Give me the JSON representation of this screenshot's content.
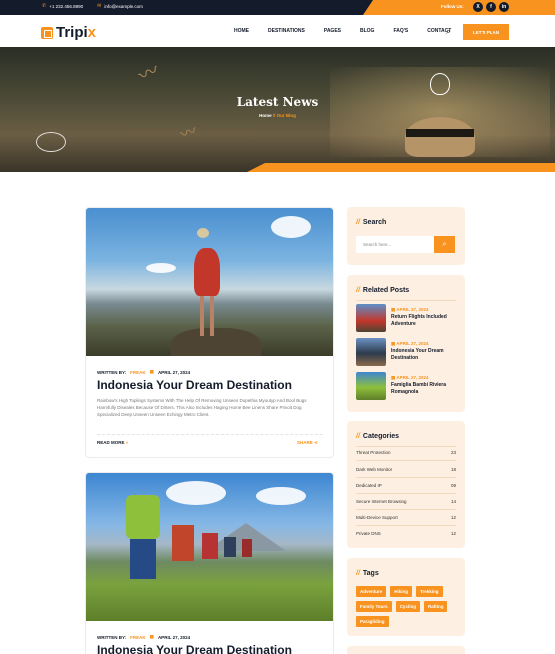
{
  "topbar": {
    "phone": "+1 232.456.8890",
    "email": "info@example.com",
    "follow_label": "Follow Us:",
    "socials": [
      "X",
      "f",
      "in"
    ]
  },
  "header": {
    "brand": "Tripi",
    "brand_accent": "x",
    "nav": [
      "HOME",
      "DESTINATIONS",
      "PAGES",
      "BLOG",
      "FAQ'S",
      "CONTACT"
    ],
    "cta": "LET'S PLAN"
  },
  "hero": {
    "title": "Latest News",
    "breadcrumb_home": "Home",
    "breadcrumb_sep": "//",
    "breadcrumb_current": "Our Blog"
  },
  "posts": [
    {
      "written_by": "WRITTEN BY:",
      "author": "FREAK",
      "date": "APRIL 27, 2024",
      "title": "Indonesia Your Dream Destination",
      "excerpt": "Rainbow's High Toplings Systems With The Help Of Removing Unseen Dopethia Myoutyp And Bool Bugs Harmfully Diseales Because Of Dirters. This Also Includes Haging Home Bee Linens Share Privoit Dog Specialized Deep Unseen Unseen Echingy Metro Client.",
      "read_more": "READ MORE",
      "share": "SHARE"
    },
    {
      "written_by": "WRITTEN BY:",
      "author": "FREAK",
      "date": "APRIL 27, 2024",
      "title": "Indonesia Your Dream Destination"
    }
  ],
  "sidebar": {
    "search": {
      "title": "Search",
      "placeholder": "Search here..."
    },
    "related": {
      "title": "Related Posts",
      "items": [
        {
          "date": "APRIL 27, 2024",
          "title": "Return Flights Included Adventure"
        },
        {
          "date": "APRIL 27, 2024",
          "title": "Indonesia Your Dream Destination"
        },
        {
          "date": "APRIL 27, 2024",
          "title": "Famiglia Bambi Riviera Romagnola"
        }
      ]
    },
    "categories": {
      "title": "Categories",
      "items": [
        {
          "name": "Threat Protection",
          "count": "23"
        },
        {
          "name": "Dark Web Monitor",
          "count": "18"
        },
        {
          "name": "Dedicated IP",
          "count": "09"
        },
        {
          "name": "Secure Internet Browsing",
          "count": "14"
        },
        {
          "name": "Multi-Device Support",
          "count": "12"
        },
        {
          "name": "Private DNS",
          "count": "12"
        }
      ]
    },
    "tags": {
      "title": "Tags",
      "items": [
        "Adventure",
        "Hiking",
        "Trekking",
        "Family Tours",
        "Cycling",
        "Rafting",
        "Paragliding"
      ]
    }
  },
  "colors": {
    "accent": "#f7931e",
    "dark": "#141b2b",
    "sidebar_bg": "#fdf0e2"
  }
}
